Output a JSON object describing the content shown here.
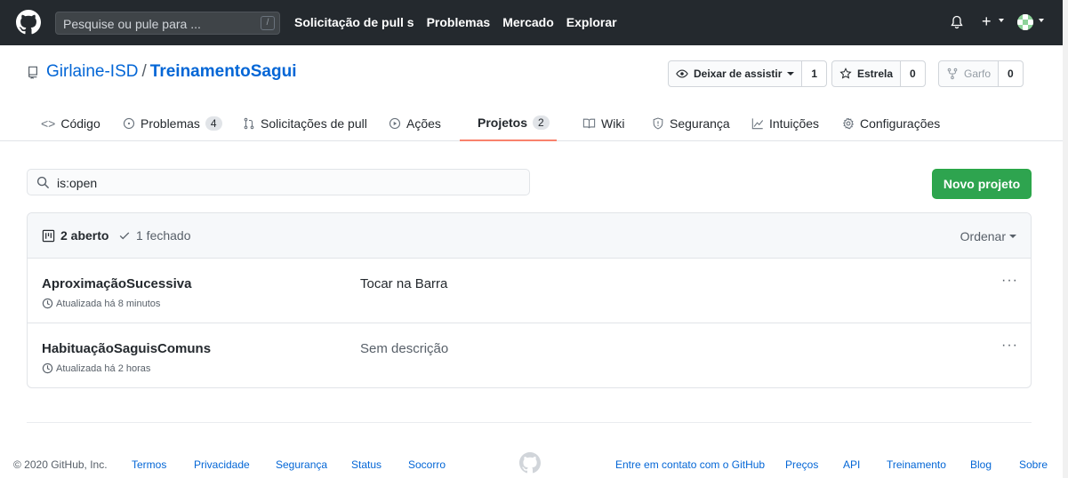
{
  "header": {
    "search_placeholder": "Pesquise ou pule para ...",
    "search_key": "/",
    "nav": [
      "Solicitação de pull s",
      "Problemas",
      "Mercado",
      "Explorar"
    ],
    "plus": "+"
  },
  "repo": {
    "owner": "Girlaine-ISD",
    "separator": "/",
    "name": "TreinamentoSagui",
    "watch_label": "Deixar de assistir",
    "watch_count": "1",
    "star_label": "Estrela",
    "star_count": "0",
    "fork_label": "Garfo",
    "fork_count": "0"
  },
  "tabs": [
    {
      "label": "Código",
      "icon": "code-icon"
    },
    {
      "label": "Problemas",
      "count": "4",
      "icon": "issue-icon"
    },
    {
      "label": "Solicitações de pull",
      "icon": "pull-request-icon"
    },
    {
      "label": "Ações",
      "icon": "play-icon"
    },
    {
      "label": "Projetos",
      "count": "2",
      "icon": "project-icon",
      "active": true
    },
    {
      "label": "Wiki",
      "icon": "book-icon"
    },
    {
      "label": "Segurança",
      "icon": "shield-icon"
    },
    {
      "label": "Intuições",
      "icon": "graph-icon"
    },
    {
      "label": "Configurações",
      "icon": "gear-icon"
    }
  ],
  "filter": {
    "value": "is:open"
  },
  "new_project_label": "Novo projeto",
  "projects_header": {
    "open_label": "2 aberto",
    "closed_label": "1 fechado",
    "sort_label": "Ordenar"
  },
  "projects": [
    {
      "name": "AproximaçãoSucessiva",
      "updated": "Atualizada há 8 minutos",
      "description": "Tocar na Barra"
    },
    {
      "name": "HabituaçãoSaguisComuns",
      "updated": "Atualizada há 2 horas",
      "description": "Sem descrição"
    }
  ],
  "row_menu": "···",
  "footer": {
    "copyright": "© 2020 GitHub, Inc.",
    "links_left": [
      "Termos",
      "Privacidade",
      "Segurança",
      "Status",
      "Socorro"
    ],
    "links_right": [
      "Entre em contato com o GitHub",
      "Preços",
      "API",
      "Treinamento",
      "Blog",
      "Sobre"
    ]
  },
  "colors": {
    "header_bg": "#24292e",
    "link": "#0366d6",
    "primary_button": "#2ea44f",
    "active_tab_underline": "#f9826c"
  }
}
